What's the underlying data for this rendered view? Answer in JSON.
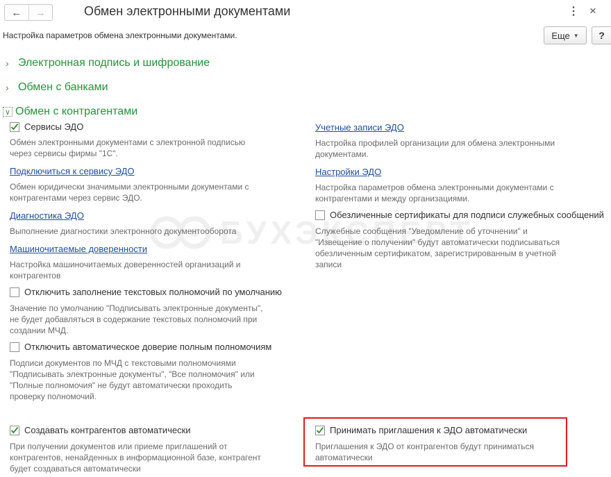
{
  "window": {
    "title": "Обмен электронными документами",
    "subtitle": "Настройка параметров обмена электронными документами.",
    "back_icon": "←",
    "forward_icon": "→",
    "menu_icon": "⋮",
    "close_icon": "×"
  },
  "toolbar": {
    "more_label": "Еще",
    "more_caret": "▼",
    "help_label": "?"
  },
  "groups": [
    {
      "label": "Электронная подпись и шифрование",
      "expanded": false,
      "chevron": "›"
    },
    {
      "label": "Обмен с банками",
      "expanded": false,
      "chevron": "›"
    },
    {
      "label": "Обмен с контрагентами",
      "expanded": true,
      "chevron": "∨"
    }
  ],
  "left": {
    "edo_services": {
      "label": "Сервисы ЭДО",
      "checked": true,
      "desc": [
        "Обмен электронными документами с электронной подписью",
        "через сервисы фирмы \"1С\"."
      ]
    },
    "connect_link": {
      "label": "Подключиться к сервису ЭДО",
      "desc": [
        "Обмен юридически значимыми электронными документами с",
        "контрагентами через сервис ЭДО."
      ]
    },
    "diagnostics_link": {
      "label": "Диагностика ЭДО",
      "desc": [
        "Выполнение диагностики электронного документооборота"
      ]
    },
    "mchd_link": {
      "label": "Машиночитаемые доверенности",
      "desc": [
        "Настройка машиночитаемых доверенностей организаций и",
        "контрагентов"
      ]
    },
    "disable_text_powers": {
      "label": "Отключить заполнение текстовых полномочий по умолчанию",
      "checked": false,
      "desc": [
        "Значение по умолчанию \"Подписывать электронные документы\",",
        "не будет добавляться в содержание текстовых полномочий при",
        "создании МЧД."
      ]
    },
    "disable_auto_trust": {
      "label": "Отключить автоматическое доверие полным полномочиям",
      "checked": false,
      "desc": [
        "Подписи документов по МЧД с текстовыми полномочиями",
        "\"Подписывать электронные документы\", \"Все полномочия\" или",
        "\"Полные полномочия\" не будут автоматически проходить",
        "проверку полномочий."
      ]
    },
    "create_counterparties": {
      "label": "Создавать контрагентов автоматически",
      "checked": true,
      "desc": [
        "При получении документов или приеме приглашений от",
        "контрагентов, ненайденных в информационной базе, контрагент",
        "будет создаваться автоматически"
      ]
    }
  },
  "right": {
    "accounts_link": {
      "label": "Учетные записи ЭДО",
      "desc": [
        "Настройка профилей организации для обмена электронными",
        "документами."
      ]
    },
    "settings_link": {
      "label": "Настройки ЭДО",
      "desc": [
        "Настройка параметров обмена электронными документами с",
        "контрагентами и между организациями."
      ]
    },
    "impersonal_certs": {
      "label": "Обезличенные сертификаты для подписи служебных сообщений",
      "checked": false,
      "desc": [
        "Служебные сообщения \"Уведомление об уточнении\" и",
        "\"Извещение о получении\" будут автоматически подписываться",
        "обезличенным сертификатом, зарегистрированным в учетной",
        "записи"
      ]
    },
    "accept_invitations": {
      "label": "Принимать приглашения к ЭДО автоматически",
      "checked": true,
      "desc": [
        "Приглашения к ЭДО от контрагентов будут приниматься",
        "автоматически"
      ]
    }
  },
  "watermark": {
    "text": "БУХЭКСПЕРТ",
    "icon": "owl-watermark-icon"
  },
  "colors": {
    "accent_green": "#26923a",
    "link_blue": "#1f4e9c",
    "highlight_red": "#e01b1b"
  }
}
